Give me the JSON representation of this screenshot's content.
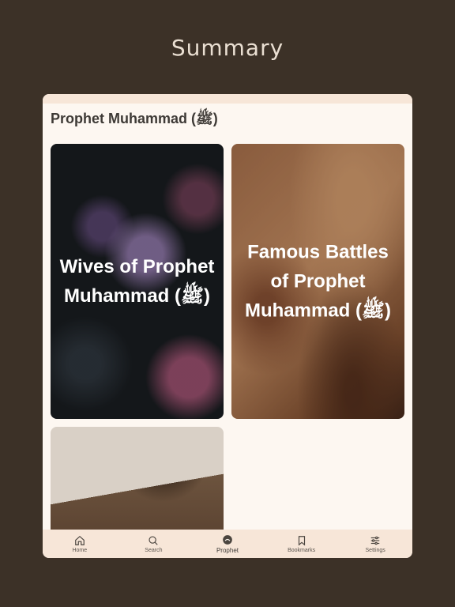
{
  "page": {
    "title": "Summary"
  },
  "section": {
    "title": "Prophet Muhammad (ﷺ)"
  },
  "cards": [
    {
      "label": "Wives of Prophet Muhammad (ﷺ)"
    },
    {
      "label": "Famous Battles of Prophet Muhammad (ﷺ)"
    },
    {
      "label": ""
    }
  ],
  "tabs": [
    {
      "label": "Home",
      "icon": "home-icon"
    },
    {
      "label": "Search",
      "icon": "search-icon"
    },
    {
      "label": "Prophet",
      "icon": "prophet-icon",
      "active": true
    },
    {
      "label": "Bookmarks",
      "icon": "bookmark-icon"
    },
    {
      "label": "Settings",
      "icon": "sliders-icon"
    }
  ],
  "colors": {
    "background": "#3c3127",
    "panel": "#fdf7f1",
    "tabbar": "#f7e6d8",
    "text": "#3e3a36"
  }
}
